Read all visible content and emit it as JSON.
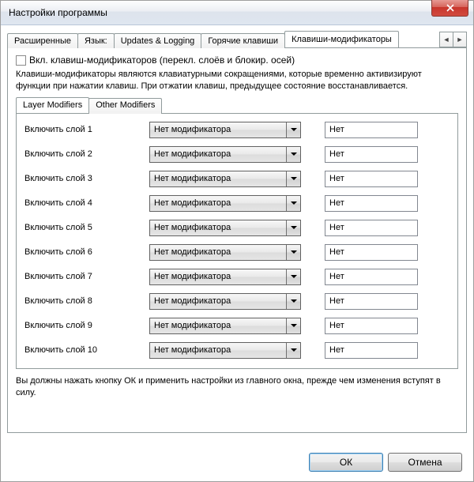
{
  "window": {
    "title": "Настройки программы"
  },
  "tabs": {
    "items": [
      "Расширенные",
      "Язык:",
      "Updates & Logging",
      "Горячие клавиши",
      "Клавиши-модификаторы"
    ],
    "active_index": 4
  },
  "checkbox": {
    "label": "Вкл. клавиш-модификаторов (перекл. слоёв и блокир. осей)"
  },
  "description": "Клавиши-модификаторы являются клавиатурными сокращениями, которые временно активизируют функции при нажатии клавиш. При отжатии клавиш, предыдущее состояние восстанавливается.",
  "inner_tabs": {
    "items": [
      "Layer Modifiers",
      "Other Modifiers"
    ],
    "active_index": 0
  },
  "rows": [
    {
      "label": "Включить слой 1",
      "combo": "Нет модификатора",
      "value": "Нет"
    },
    {
      "label": "Включить слой 2",
      "combo": "Нет модификатора",
      "value": "Нет"
    },
    {
      "label": "Включить слой 3",
      "combo": "Нет модификатора",
      "value": "Нет"
    },
    {
      "label": "Включить слой 4",
      "combo": "Нет модификатора",
      "value": "Нет"
    },
    {
      "label": "Включить слой 5",
      "combo": "Нет модификатора",
      "value": "Нет"
    },
    {
      "label": "Включить слой 6",
      "combo": "Нет модификатора",
      "value": "Нет"
    },
    {
      "label": "Включить слой 7",
      "combo": "Нет модификатора",
      "value": "Нет"
    },
    {
      "label": "Включить слой 8",
      "combo": "Нет модификатора",
      "value": "Нет"
    },
    {
      "label": "Включить слой 9",
      "combo": "Нет модификатора",
      "value": "Нет"
    },
    {
      "label": "Включить слой 10",
      "combo": "Нет модификатора",
      "value": "Нет"
    }
  ],
  "footnote": "Вы должны нажать кнопку ОК и применить настройки из главного окна, прежде чем изменения вступят в силу.",
  "buttons": {
    "ok": "ОК",
    "cancel": "Отмена"
  }
}
